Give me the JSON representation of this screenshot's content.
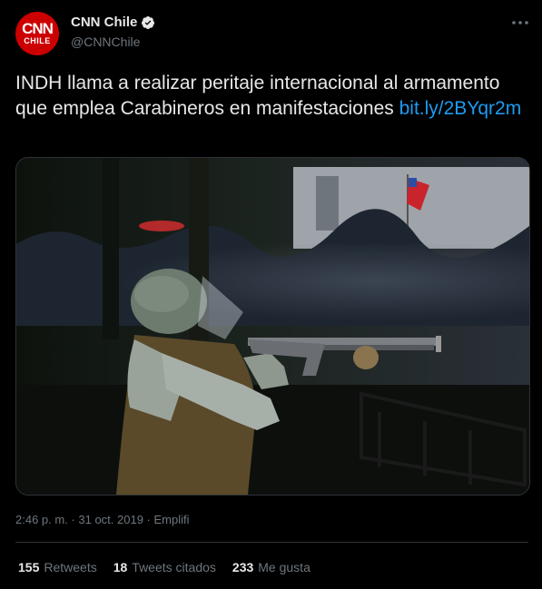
{
  "account": {
    "avatar_line1": "CNN",
    "avatar_line2": "CHILE",
    "name": "CNN Chile",
    "handle": "@CNNChile"
  },
  "tweet": {
    "text": "INDH llama a realizar peritaje internacional al armamento que emplea Carabineros en manifestaciones ",
    "link": "bit.ly/2BYqr2m",
    "media_alt": "Carabinero con casco y escopeta antidisturbios apuntando, con manifestantes y una bandera de Chile al fondo"
  },
  "meta": {
    "time": "2:46 p. m.",
    "date": "31 oct. 2019",
    "source": "Emplifi",
    "separator": " · "
  },
  "stats": {
    "retweets_count": "155",
    "retweets_label": "Retweets",
    "quotes_count": "18",
    "quotes_label": "Tweets citados",
    "likes_count": "233",
    "likes_label": "Me gusta"
  },
  "colors": {
    "background": "#000000",
    "link": "#1d9bf0",
    "avatar": "#cc0000",
    "muted": "#6e767d"
  },
  "icons": [
    "verified-badge-icon",
    "more-options-icon"
  ]
}
